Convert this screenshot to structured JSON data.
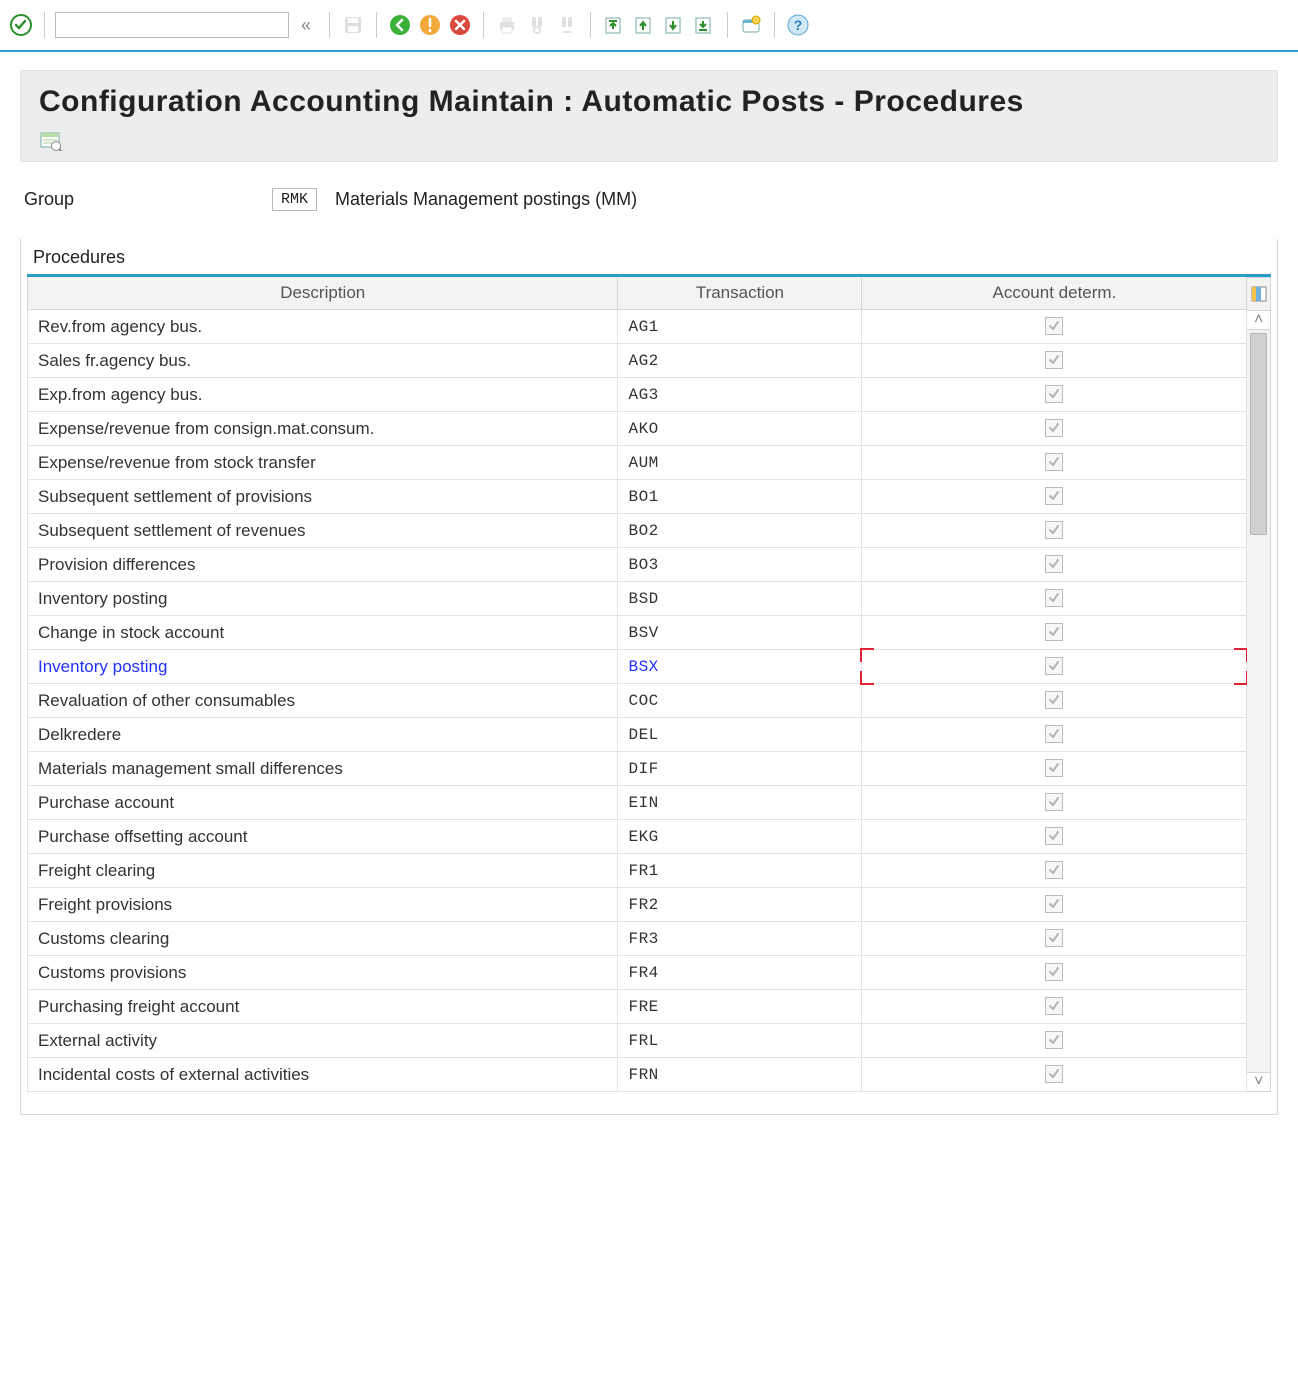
{
  "title": "Configuration Accounting Maintain : Automatic Posts - Procedures",
  "group": {
    "label": "Group",
    "code": "RMK",
    "desc": "Materials Management postings (MM)"
  },
  "procedures_caption": "Procedures",
  "columns": {
    "description": "Description",
    "transaction": "Transaction",
    "account_determ": "Account determ."
  },
  "rows": [
    {
      "desc": "Rev.from agency bus.",
      "tx": "AG1",
      "acc": true
    },
    {
      "desc": "Sales fr.agency bus.",
      "tx": "AG2",
      "acc": true
    },
    {
      "desc": "Exp.from agency bus.",
      "tx": "AG3",
      "acc": true
    },
    {
      "desc": "Expense/revenue from consign.mat.consum.",
      "tx": "AKO",
      "acc": true
    },
    {
      "desc": "Expense/revenue from stock transfer",
      "tx": "AUM",
      "acc": true
    },
    {
      "desc": "Subsequent settlement of provisions",
      "tx": "BO1",
      "acc": true
    },
    {
      "desc": "Subsequent settlement of revenues",
      "tx": "BO2",
      "acc": true
    },
    {
      "desc": "Provision differences",
      "tx": "BO3",
      "acc": true
    },
    {
      "desc": "Inventory posting",
      "tx": "BSD",
      "acc": true
    },
    {
      "desc": "Change in stock account",
      "tx": "BSV",
      "acc": true
    },
    {
      "desc": "Inventory posting",
      "tx": "BSX",
      "acc": true,
      "selected": true
    },
    {
      "desc": "Revaluation of other consumables",
      "tx": "COC",
      "acc": true
    },
    {
      "desc": "Delkredere",
      "tx": "DEL",
      "acc": true
    },
    {
      "desc": "Materials management small differences",
      "tx": "DIF",
      "acc": true
    },
    {
      "desc": "Purchase account",
      "tx": "EIN",
      "acc": true
    },
    {
      "desc": "Purchase offsetting account",
      "tx": "EKG",
      "acc": true
    },
    {
      "desc": "Freight clearing",
      "tx": "FR1",
      "acc": true
    },
    {
      "desc": "Freight provisions",
      "tx": "FR2",
      "acc": true
    },
    {
      "desc": "Customs clearing",
      "tx": "FR3",
      "acc": true
    },
    {
      "desc": "Customs provisions",
      "tx": "FR4",
      "acc": true
    },
    {
      "desc": "Purchasing freight account",
      "tx": "FRE",
      "acc": true
    },
    {
      "desc": "External activity",
      "tx": "FRL",
      "acc": true
    },
    {
      "desc": "Incidental costs of external activities",
      "tx": "FRN",
      "acc": true
    }
  ],
  "command_value": "",
  "command_placeholder": ""
}
